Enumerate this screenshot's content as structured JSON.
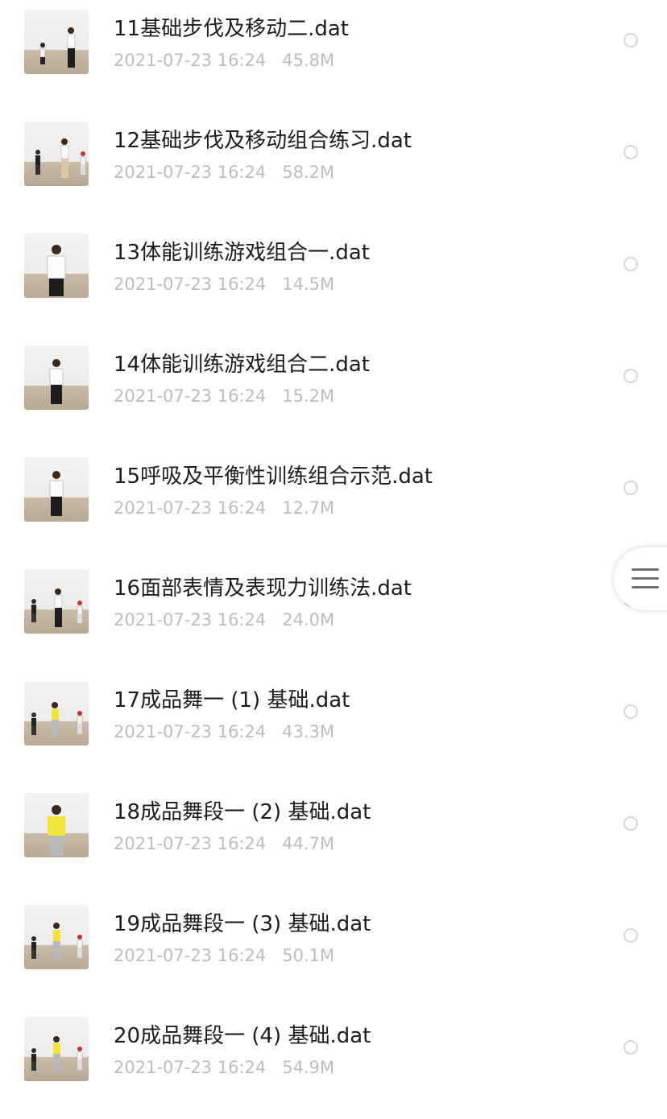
{
  "files": [
    {
      "name": "11基础步伐及移动二.dat",
      "date": "2021-07-23 16:24",
      "size": "45.8M",
      "thumbnail_icon": "video-thumbnail-icon"
    },
    {
      "name": "12基础步伐及移动组合练习.dat",
      "date": "2021-07-23 16:24",
      "size": "58.2M",
      "thumbnail_icon": "video-thumbnail-icon"
    },
    {
      "name": "13体能训练游戏组合一.dat",
      "date": "2021-07-23 16:24",
      "size": "14.5M",
      "thumbnail_icon": "video-thumbnail-icon"
    },
    {
      "name": "14体能训练游戏组合二.dat",
      "date": "2021-07-23 16:24",
      "size": "15.2M",
      "thumbnail_icon": "video-thumbnail-icon"
    },
    {
      "name": "15呼吸及平衡性训练组合示范.dat",
      "date": "2021-07-23 16:24",
      "size": "12.7M",
      "thumbnail_icon": "video-thumbnail-icon"
    },
    {
      "name": "16面部表情及表现力训练法.dat",
      "date": "2021-07-23 16:24",
      "size": "24.0M",
      "thumbnail_icon": "video-thumbnail-icon"
    },
    {
      "name": "17成品舞一 (1) 基础.dat",
      "date": "2021-07-23 16:24",
      "size": "43.3M",
      "thumbnail_icon": "video-thumbnail-icon"
    },
    {
      "name": "18成品舞段一 (2) 基础.dat",
      "date": "2021-07-23 16:24",
      "size": "44.7M",
      "thumbnail_icon": "video-thumbnail-icon"
    },
    {
      "name": "19成品舞段一 (3) 基础.dat",
      "date": "2021-07-23 16:24",
      "size": "50.1M",
      "thumbnail_icon": "video-thumbnail-icon"
    },
    {
      "name": "20成品舞段一 (4) 基础.dat",
      "date": "2021-07-23 16:24",
      "size": "54.9M",
      "thumbnail_icon": "video-thumbnail-icon"
    }
  ],
  "floating_menu": {
    "icon": "hamburger-menu-icon"
  },
  "colors": {
    "name_text": "#1c1c1c",
    "meta_text": "#bdbdbd",
    "radio_border": "#d7d7d7",
    "background": "#ffffff"
  }
}
